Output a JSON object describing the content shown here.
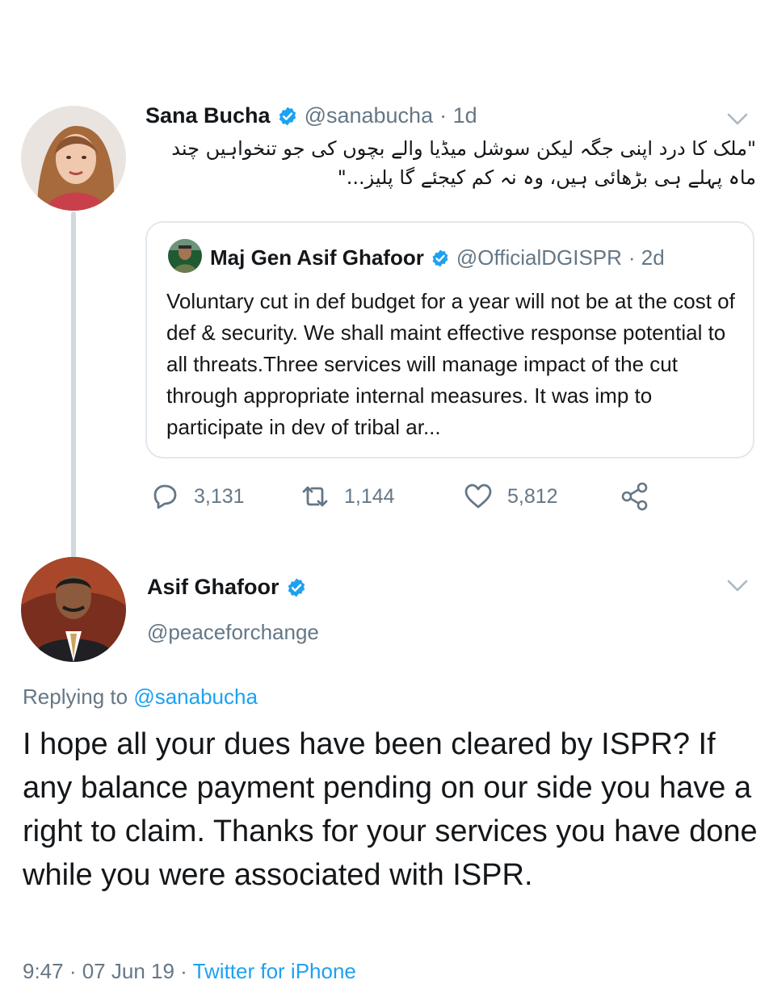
{
  "tweet1": {
    "name": "Sana Bucha",
    "handle": "@sanabucha",
    "time": "· 1d",
    "text": "\"ملک کا درد اپنی جگہ لیکن سوشل میڈیا والے بچوں کی جو تنخواہیں چند ماہ پہلے ہی بڑھائی ہیں، وہ نہ کم کیجئے گا پلیز...\"",
    "avatar_icon": "woman-portrait-avatar",
    "menu_icon": "chevron-down-icon"
  },
  "quote": {
    "name": "Maj Gen Asif Ghafoor",
    "handle": "@OfficialDGISPR",
    "time": "· 2d",
    "text": "Voluntary cut in def budget for a year will not be at the cost of def & security. We shall maint effective response potential to all threats.Three services will manage impact of the cut through appropriate internal measures. It was imp to participate in dev of tribal ar...",
    "avatar_icon": "uniformed-officer-avatar"
  },
  "actions": {
    "reply_count": "3,131",
    "retweet_count": "1,144",
    "like_count": "5,812",
    "reply_icon": "reply-bubble-icon",
    "retweet_icon": "retweet-icon",
    "like_icon": "heart-icon",
    "share_icon": "share-icon"
  },
  "tweet2": {
    "name": "Asif Ghafoor",
    "handle": "@peaceforchange",
    "replying_prefix": "Replying to",
    "replying_to": "@sanabucha",
    "text": "I hope all your dues have been cleared by ISPR? If any balance payment pending on our side you have a right to claim. Thanks for your services you have done while you were associated with ISPR.",
    "footer_time": "9:47 · 07 Jun 19 ·",
    "footer_source": "Twitter for iPhone",
    "avatar_icon": "man-in-suit-avatar"
  },
  "colors": {
    "accent": "#1da1f2",
    "muted": "#657786",
    "border": "#e1e8ed",
    "text": "#14171a"
  }
}
